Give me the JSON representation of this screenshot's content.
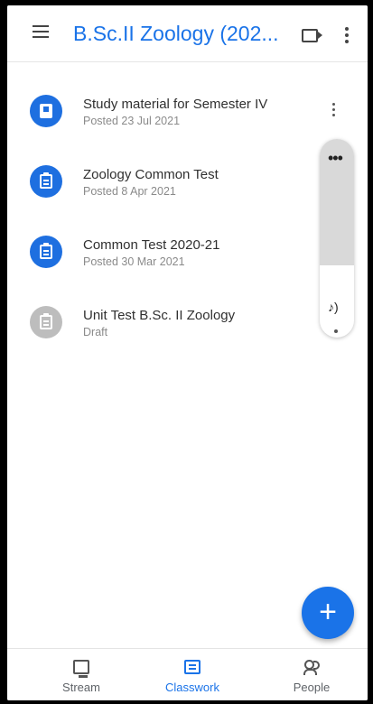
{
  "appbar": {
    "title": "B.Sc.II Zoology (202...",
    "icons": [
      "menu-icon",
      "video-icon",
      "more-vert-icon"
    ]
  },
  "classwork": {
    "items": [
      {
        "title": "Study material for Semester IV",
        "subtitle": "Posted 23 Jul 2021",
        "icon": "book-icon",
        "color": "#1e6fe0"
      },
      {
        "title": "Zoology Common Test",
        "subtitle": "Posted 8 Apr 2021",
        "icon": "assignment-icon",
        "color": "#1e6fe0"
      },
      {
        "title": "Common Test 2020-21",
        "subtitle": "Posted 30 Mar 2021",
        "icon": "assignment-icon",
        "color": "#1e6fe0"
      },
      {
        "title": "Unit Test  B.Sc. II Zoology",
        "subtitle": "Draft",
        "icon": "assignment-icon",
        "color": "#bdbdbd"
      }
    ]
  },
  "side_panel": {
    "more": "•••",
    "speaker": "♪)"
  },
  "fab": {
    "label": "+"
  },
  "bottom_nav": {
    "tabs": [
      {
        "label": "Stream",
        "active": false
      },
      {
        "label": "Classwork",
        "active": true
      },
      {
        "label": "People",
        "active": false
      }
    ]
  },
  "colors": {
    "accent": "#1a73e8",
    "draft": "#bdbdbd"
  }
}
